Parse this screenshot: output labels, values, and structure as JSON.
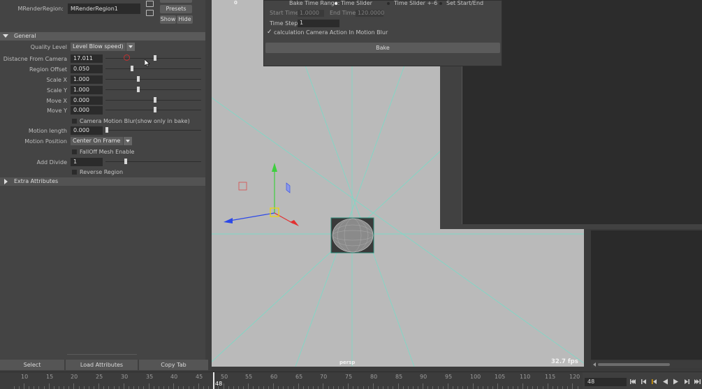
{
  "attr_editor": {
    "node_label": "MRenderRegion:",
    "node_name": "MRenderRegion1",
    "presets_button": "Presets",
    "show_button": "Show",
    "hide_button": "Hide",
    "section_general": "General",
    "section_extra": "Extra Attributes",
    "quality_label": "Quality Level",
    "quality_value": "Level Blow speed)",
    "rows": [
      {
        "label": "Distacne From Camera",
        "value": "17.011",
        "slider": 0.5
      },
      {
        "label": "Region Offset",
        "value": "0.050",
        "slider": 0.26
      },
      {
        "label": "Scale X",
        "value": "1.000",
        "slider": 0.33
      },
      {
        "label": "Scale Y",
        "value": "1.000",
        "slider": 0.33
      },
      {
        "label": "Move X",
        "value": "0.000",
        "slider": 0.5
      },
      {
        "label": "Move Y",
        "value": "0.000",
        "slider": 0.5
      }
    ],
    "camera_blur_label": "Camera Motion Blur(show only in bake)",
    "motion_length_label": "Motion length",
    "motion_length_value": "0.000",
    "motion_position_label": "Motion Position",
    "motion_position_value": "Center On Frame",
    "falloff_label": "FallOff Mesh Enable",
    "add_divide_label": "Add Divide",
    "add_divide_value": "1",
    "reverse_label": "Reverse Region",
    "select_button": "Select",
    "load_button": "Load Attributes",
    "copy_button": "Copy Tab"
  },
  "viewport": {
    "camera_name": "persp",
    "fps": "32.7 fps",
    "top_number": "0"
  },
  "bake_dialog": {
    "range_label": "Bake Time Range:",
    "opt_time_slider": "Time Slider",
    "opt_time_slider_pm": "Time Slider +-6",
    "opt_set_start_end": "Set Start/End",
    "start_label": "Start Time:",
    "start_value": "1.0000",
    "end_label": "End Time:",
    "end_value": "120.0000",
    "step_label": "Time Step:",
    "step_value": "1",
    "calc_label": "calculation Camera Action In Motion Blur",
    "bake_button": "Bake"
  },
  "timeline": {
    "labels": [
      "10",
      "15",
      "20",
      "25",
      "30",
      "35",
      "40",
      "45",
      "50",
      "55",
      "60",
      "65",
      "70",
      "75",
      "80",
      "85",
      "90",
      "95",
      "100",
      "105",
      "110",
      "115",
      "120"
    ],
    "current_frame": "48",
    "current_frame_field": "48"
  },
  "colors": {
    "grid_line": "#7fd8c6",
    "axis_x": "#e23030",
    "axis_y": "#3ecf3e",
    "axis_z": "#2b48e8"
  }
}
